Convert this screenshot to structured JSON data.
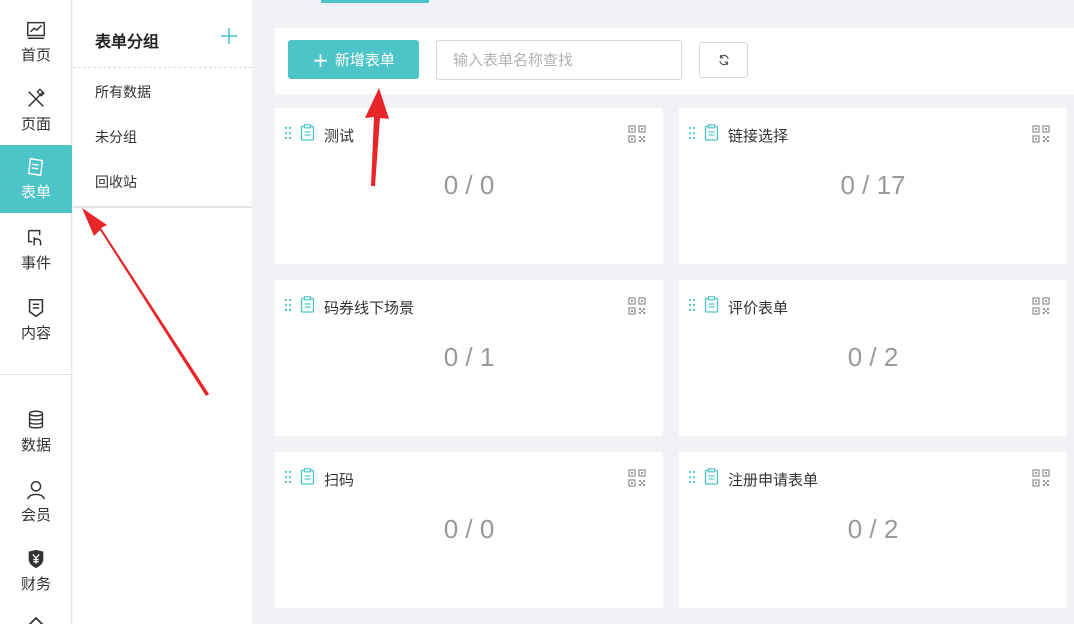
{
  "nav": {
    "items": [
      {
        "label": "首页",
        "icon": "chart-line-icon"
      },
      {
        "label": "页面",
        "icon": "design-tools-icon"
      },
      {
        "label": "表单",
        "icon": "form-icon",
        "active": true
      },
      {
        "label": "事件",
        "icon": "touch-icon"
      },
      {
        "label": "内容",
        "icon": "content-icon"
      },
      {
        "label": "数据",
        "icon": "database-icon"
      },
      {
        "label": "会员",
        "icon": "user-icon"
      },
      {
        "label": "财务",
        "icon": "yuan-shield-icon"
      }
    ]
  },
  "groups": {
    "title": "表单分组",
    "items": [
      "所有数据",
      "未分组",
      "回收站"
    ]
  },
  "toolbar": {
    "new_label": "新增表单",
    "search_placeholder": "输入表单名称查找"
  },
  "forms": [
    {
      "name": "测试",
      "count": "0 / 0"
    },
    {
      "name": "链接选择",
      "count": "0 / 17"
    },
    {
      "name": "码券线下场景",
      "count": "0 / 1"
    },
    {
      "name": "评价表单",
      "count": "0 / 2"
    },
    {
      "name": "扫码",
      "count": "0 / 0"
    },
    {
      "name": "注册申请表单",
      "count": "0 / 2"
    }
  ],
  "colors": {
    "accent": "#4dc4c7",
    "arrow": "#e8262a"
  }
}
